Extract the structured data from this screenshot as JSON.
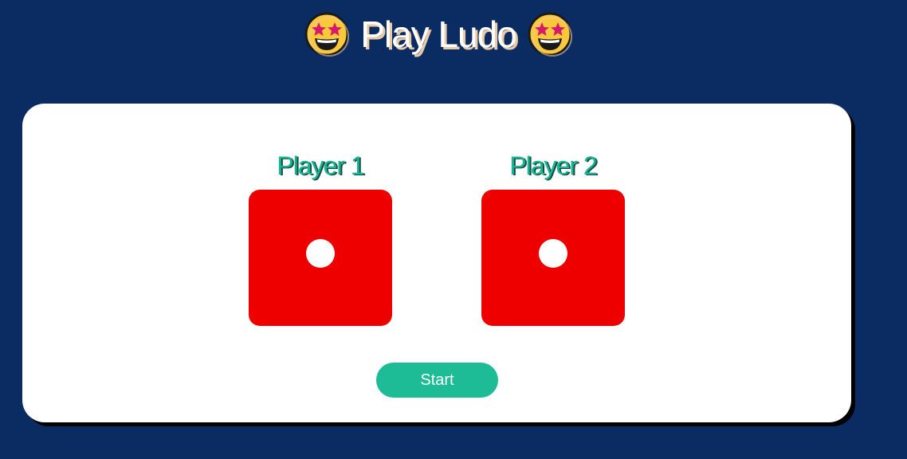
{
  "header": {
    "title": "Play Ludo",
    "left_emoji": "star-struck-emoji-icon",
    "right_emoji": "star-struck-emoji-icon"
  },
  "players": [
    {
      "name": "Player 1",
      "dice_value": 1
    },
    {
      "name": "Player 2",
      "dice_value": 1
    }
  ],
  "controls": {
    "start_label": "Start"
  },
  "colors": {
    "background": "#0b2c63",
    "card": "#ffffff",
    "die": "#ef0000",
    "pip": "#ffffff",
    "player_name": "#17b596",
    "start_button": "#1dbb96"
  }
}
